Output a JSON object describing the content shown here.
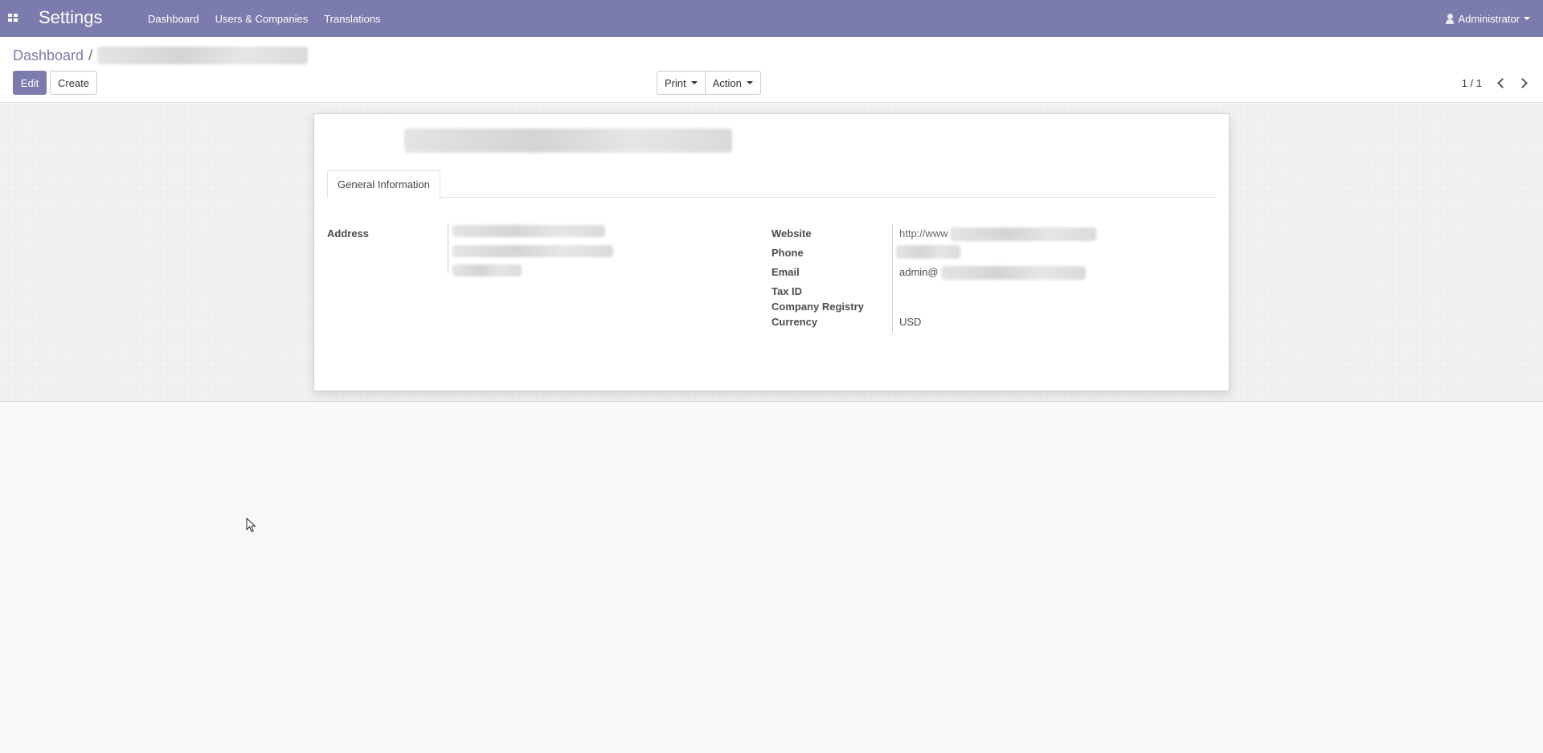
{
  "navbar": {
    "app_title": "Settings",
    "menu": [
      "Dashboard",
      "Users & Companies",
      "Translations"
    ],
    "user": "Administrator",
    "background": "#7c7bad"
  },
  "control_panel": {
    "breadcrumb_root": "Dashboard",
    "breadcrumb_sep": "/",
    "edit_label": "Edit",
    "create_label": "Create",
    "print_label": "Print",
    "action_label": "Action",
    "pager": "1 / 1"
  },
  "form": {
    "tab_label": "General Information",
    "address_label": "Address",
    "website_label": "Website",
    "website_value": "http://www",
    "phone_label": "Phone",
    "email_label": "Email",
    "email_value": "admin@",
    "tax_id_label": "Tax ID",
    "company_registry_label": "Company Registry",
    "currency_label": "Currency",
    "currency_value": "USD"
  },
  "icons": {
    "apps": "apps-grid-icon",
    "user": "user-icon",
    "prev": "chevron-left-icon",
    "next": "chevron-right-icon",
    "cursor": "mouse-cursor-icon"
  }
}
